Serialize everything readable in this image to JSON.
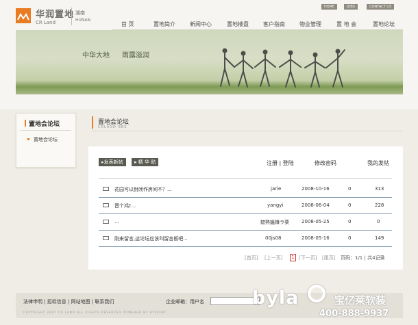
{
  "header": {
    "logo_cn": "华润置地",
    "logo_en": "CR Land",
    "region_cn": "湖南",
    "region_en": "HUNAN",
    "top_links": [
      "HOME",
      "JOBS",
      "CONTACT US"
    ],
    "nav": [
      "首 页",
      "置地简介",
      "新闻中心",
      "置地楼盘",
      "客户指南",
      "物业管理",
      "置 地 会",
      "置地论坛"
    ]
  },
  "banner": {
    "slogan1": "中华大地",
    "slogan2": "雨露滋润"
  },
  "sidebar": {
    "title": "置地会论坛",
    "item": "置地会论坛"
  },
  "main": {
    "title": "置地会论坛",
    "subtitle": "CRLAND BBS",
    "buttons": {
      "new_post": "发表新帖",
      "elite": "精 华 贴"
    },
    "links": {
      "register_login": "注册 | 登陆",
      "change_password": "修改密码",
      "my_posts": "我的发帖"
    },
    "topics": [
      {
        "title": "花园可以封闭作房间不？...",
        "author": "jarie",
        "date": "2008-10-16",
        "replies": "0",
        "views": "313"
      },
      {
        "title": "晋个鸿†...",
        "author": "yangyi",
        "date": "2008-06-04",
        "replies": "0",
        "views": "228"
      },
      {
        "title": "...",
        "author": "鍃熱媼撙ラ栗",
        "date": "2008-05-25",
        "replies": "0",
        "views": "0"
      },
      {
        "title": "刚来留言,这论坛应该叫留言板吧...",
        "author": "00js08",
        "date": "2008-05-16",
        "replies": "0",
        "views": "149"
      }
    ],
    "pager": {
      "first": "[首页]",
      "prev": "[上一页]",
      "current": "1",
      "next": "[下一页]",
      "last": "[尾页]",
      "info": "页码：1/1 | 共4记录"
    }
  },
  "footer": {
    "links": "法律申明 | 招标信息 | 网站地图 | 联系我们",
    "email_label": "企业邮箱：用户名",
    "copyright": "COPYRIGHT 2007 CR LAND  ALL RIGHTS RESERVED  POWERED BY HYPOINT"
  },
  "watermark": {
    "word": "byla",
    "brand_cn": "宝亿莱软装",
    "phone": "400-888-9937"
  },
  "colors": {
    "accent": "#e97c22",
    "row_line": "#7e97ae"
  }
}
